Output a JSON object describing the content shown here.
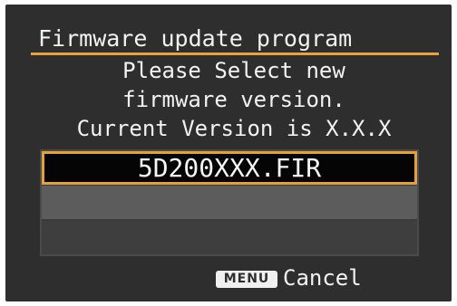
{
  "screen": {
    "title": "Firmware update program",
    "message_lines": [
      "Please Select new",
      "firmware version.",
      "Current Version is X.X.X"
    ]
  },
  "file_list": {
    "items": [
      "5D200XXX.FIR",
      "",
      ""
    ],
    "selected_index": 0
  },
  "footer": {
    "menu_key_label": "MENU",
    "cancel_label": "Cancel"
  },
  "colors": {
    "accent": "#e9a23b",
    "background": "#2e2e2e",
    "text": "#f2f2f2"
  }
}
